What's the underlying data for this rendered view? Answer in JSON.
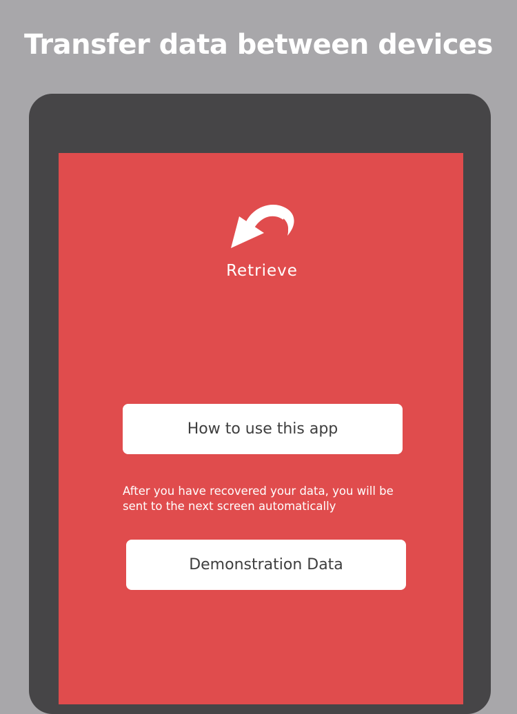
{
  "headline": "Transfer data between devices",
  "app": {
    "logo_icon": "curved-arrow-down-left-icon",
    "logo_title": "Retrieve"
  },
  "buttons": {
    "help_label": "How to use this app",
    "demo_label": "Demonstration Data"
  },
  "note": "After you have recovered your data, you will be sent to the next screen automatically",
  "colors": {
    "background": "#a8a7aa",
    "device": "#464547",
    "screen": "#e04c4d",
    "button": "#ffffff",
    "button_text": "#3e3e3e"
  }
}
